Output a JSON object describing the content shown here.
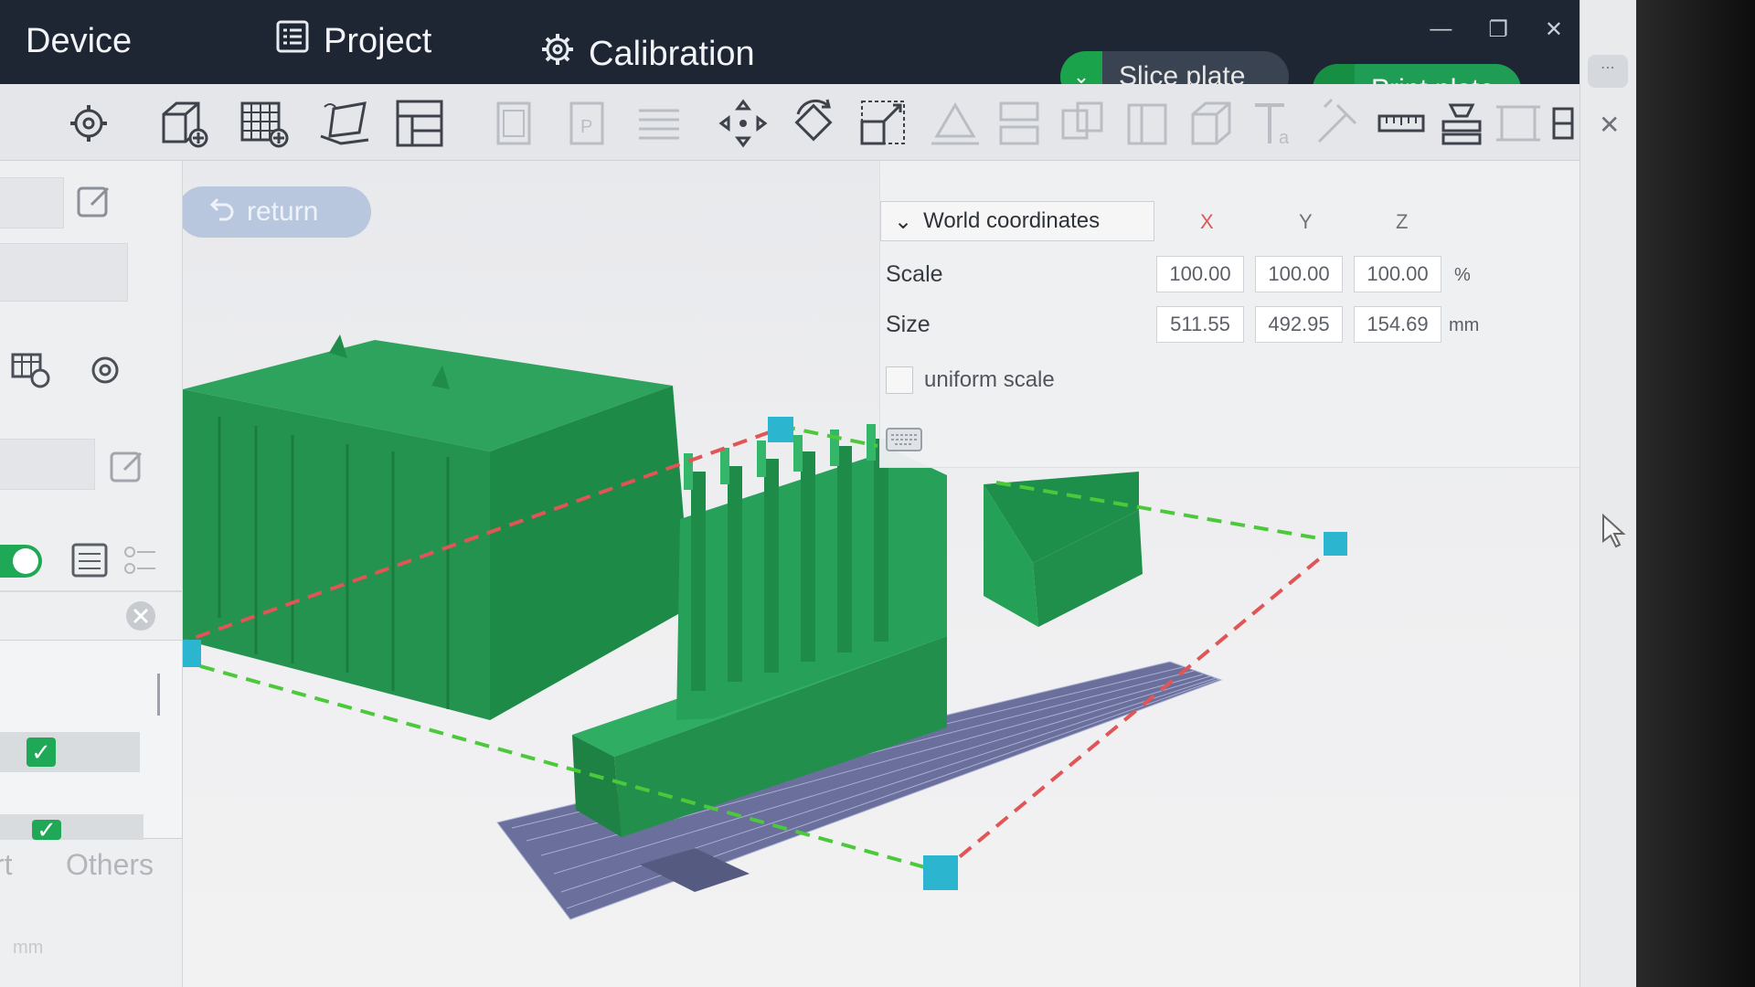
{
  "tabs": {
    "device": "Device",
    "project": "Project",
    "calibration": "Calibration"
  },
  "actions": {
    "slice_plate": "Slice plate",
    "print_plate": "Print plate"
  },
  "viewport": {
    "return_label": "return"
  },
  "transform": {
    "coordinate_mode": "World coordinates",
    "axes": [
      "X",
      "Y",
      "Z"
    ],
    "scale_label": "Scale",
    "scale": {
      "x": "100.00",
      "y": "100.00",
      "z": "100.00",
      "unit": "%"
    },
    "size_label": "Size",
    "size": {
      "x": "511.55",
      "y": "492.95",
      "z": "154.69",
      "unit": "mm"
    },
    "uniform_scale_label": "uniform scale"
  },
  "left_panel": {
    "bottom_tabs": [
      "rt",
      "Others"
    ],
    "unit": "mm"
  },
  "colors": {
    "titlebar": "#1e2633",
    "accent_green": "#1fa855",
    "model_green": "#27a55c",
    "axis_x": "#e05555",
    "axis_y": "#4cc93b",
    "bbox_corner": "#2bb5cf",
    "plate": "#5f6a9a"
  },
  "icons": {
    "project": "list-icon",
    "calibration": "gear-icon",
    "toolbar": [
      "add-cube-icon",
      "add-plate-icon",
      "orient-icon",
      "arrange-icon",
      "copy-icon",
      "paste-icon",
      "layers-icon",
      "move-icon",
      "rotate-icon",
      "scale-icon",
      "lay-flat-icon",
      "cut-icon",
      "split-icon",
      "boolean-icon",
      "support-icon",
      "text-icon",
      "seam-icon",
      "measure-icon",
      "assembly-icon",
      "frame-icon",
      "more-icon"
    ]
  }
}
